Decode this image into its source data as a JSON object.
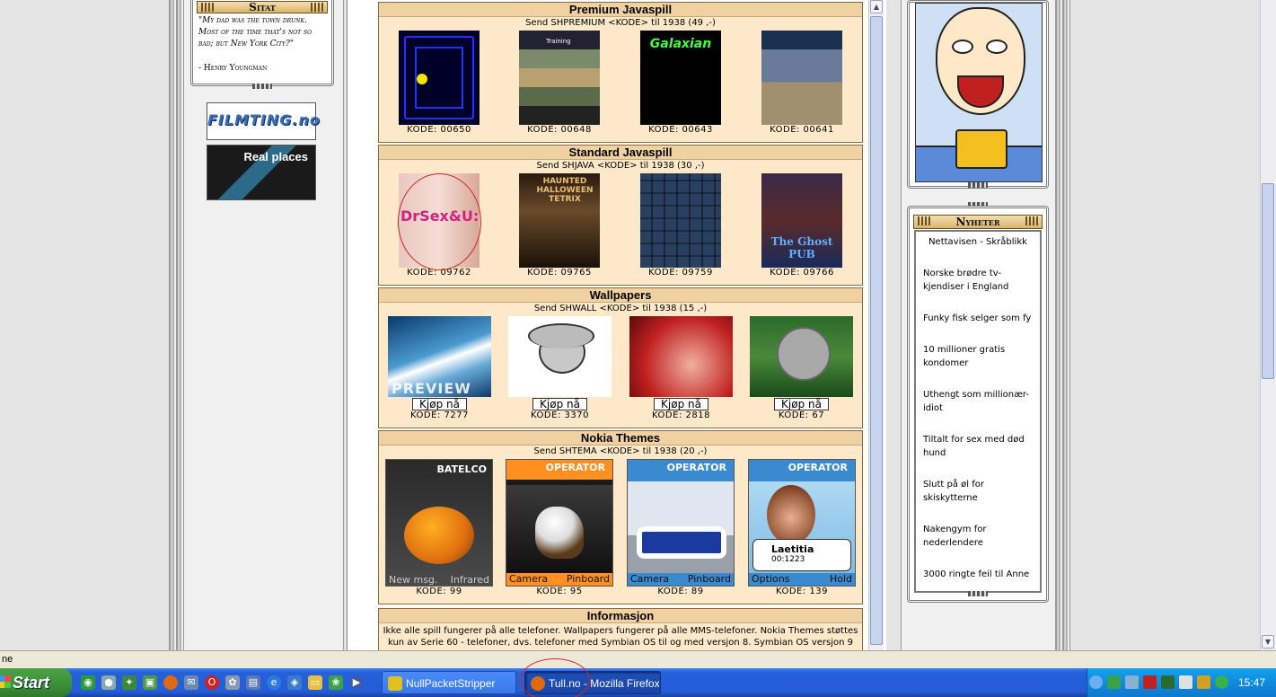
{
  "left": {
    "quote_box": {
      "title": "Sitat",
      "text": "\"My dad was the town drunk. Most of the time that's not so bad; but New York City?\"",
      "author": "- Henry Youngman"
    },
    "banners": [
      {
        "label": "FILMTING.no"
      },
      {
        "label": "Real places"
      }
    ]
  },
  "sections": {
    "premium": {
      "title": "Premium Javaspill",
      "subtitle": "Send SHPREMIUM <KODE> til 1938 (49 ,-)",
      "items": [
        {
          "code": "KODE: 00650"
        },
        {
          "code": "KODE: 00648",
          "thumb_text": "Training"
        },
        {
          "code": "KODE: 00643",
          "thumb_text": "Galaxian"
        },
        {
          "code": "KODE: 00641"
        }
      ]
    },
    "standard": {
      "title": "Standard Javaspill",
      "subtitle": "Send SHJAVA <KODE> til 1938 (30 ,-)",
      "items": [
        {
          "code": "KODE: 09762",
          "thumb_text": "DrSex&U:"
        },
        {
          "code": "KODE: 09765",
          "thumb_text": "HAUNTED HALLOWEEN TETRIX"
        },
        {
          "code": "KODE: 09759"
        },
        {
          "code": "KODE: 09766",
          "thumb_text": "The Ghost PUB"
        }
      ]
    },
    "wallpapers": {
      "title": "Wallpapers",
      "subtitle": "Send SHWALL <KODE> til 1938 (15 ,-)",
      "buy_label": "Kjøp nå",
      "items": [
        {
          "code": "KODE: 7277",
          "thumb_text": "PREVIEW"
        },
        {
          "code": "KODE: 3370"
        },
        {
          "code": "KODE: 2818"
        },
        {
          "code": "KODE: 67"
        }
      ]
    },
    "themes": {
      "title": "Nokia Themes",
      "subtitle": "Send SHTEMA <KODE> til 1938 (20 ,-)",
      "items": [
        {
          "code": "KODE: 99",
          "top": "BATELCO",
          "left_soft": "New msg.",
          "right_soft": "Infrared"
        },
        {
          "code": "KODE: 95",
          "top": "OPERATOR",
          "left_soft": "Camera",
          "right_soft": "Pinboard"
        },
        {
          "code": "KODE: 89",
          "top": "OPERATOR",
          "left_soft": "Camera",
          "right_soft": "Pinboard"
        },
        {
          "code": "KODE: 139",
          "top": "OPERATOR",
          "left_soft": "Options",
          "right_soft": "Hold",
          "caller": "Laetitia",
          "caller_time": "00:1223"
        }
      ]
    },
    "info": {
      "title": "Informasjon",
      "text": "Ikke alle spill fungerer på alle telefoner. Wallpapers fungerer på alle MMS-telefoner. Nokia Themes støttes kun av Serie 60 - telefoner, dvs. telefoner med Symbian OS til og med versjon 8. Symbian OS versjon 9"
    }
  },
  "right": {
    "news": {
      "title": "Nyheter",
      "source": "Nettavisen - Skråblikk",
      "items": [
        "Norske brødre tv-kjendiser i England",
        "Funky fisk selger som fy",
        "10 millioner gratis kondomer",
        "Uthengt som millionær-idiot",
        "Tiltalt for sex med død hund",
        "Slutt på øl for skiskytterne",
        "Nakengym for nederlendere",
        "3000 ringte feil til Anne"
      ]
    }
  },
  "statusbar": {
    "text": "ne"
  },
  "taskbar": {
    "start_label": "Start",
    "tasks": [
      {
        "label": "NullPacketStripper"
      },
      {
        "label": "Tull.no - Mozilla Firefox"
      }
    ],
    "clock": "15:47"
  }
}
